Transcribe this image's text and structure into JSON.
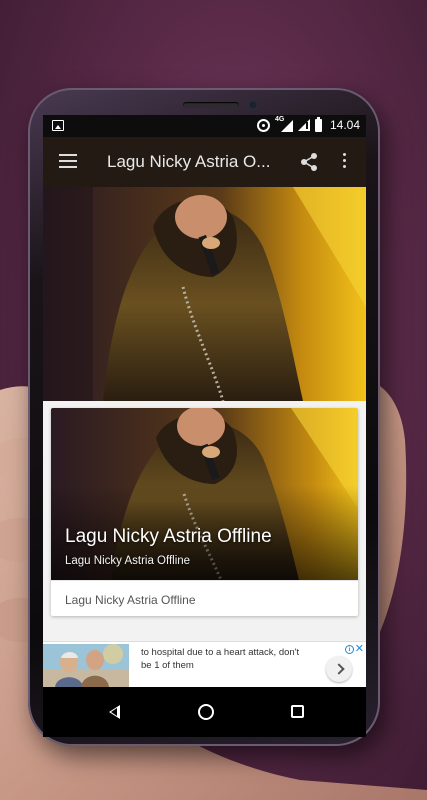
{
  "status_bar": {
    "network_label": "4G",
    "time": "14.04"
  },
  "app_bar": {
    "title": "Lagu Nicky Astria O..."
  },
  "card": {
    "title": "Lagu Nicky Astria Offline",
    "subtitle": "Lagu Nicky Astria Offline",
    "footer": "Lagu Nicky Astria Offline"
  },
  "ad": {
    "text": "to hospital due to a heart attack, don't be 1 of them",
    "info_label": "i",
    "close_label": "✕"
  },
  "colors": {
    "app_bar": "#231a14",
    "accent": "#1c8adb",
    "background": "#5a2a48"
  }
}
